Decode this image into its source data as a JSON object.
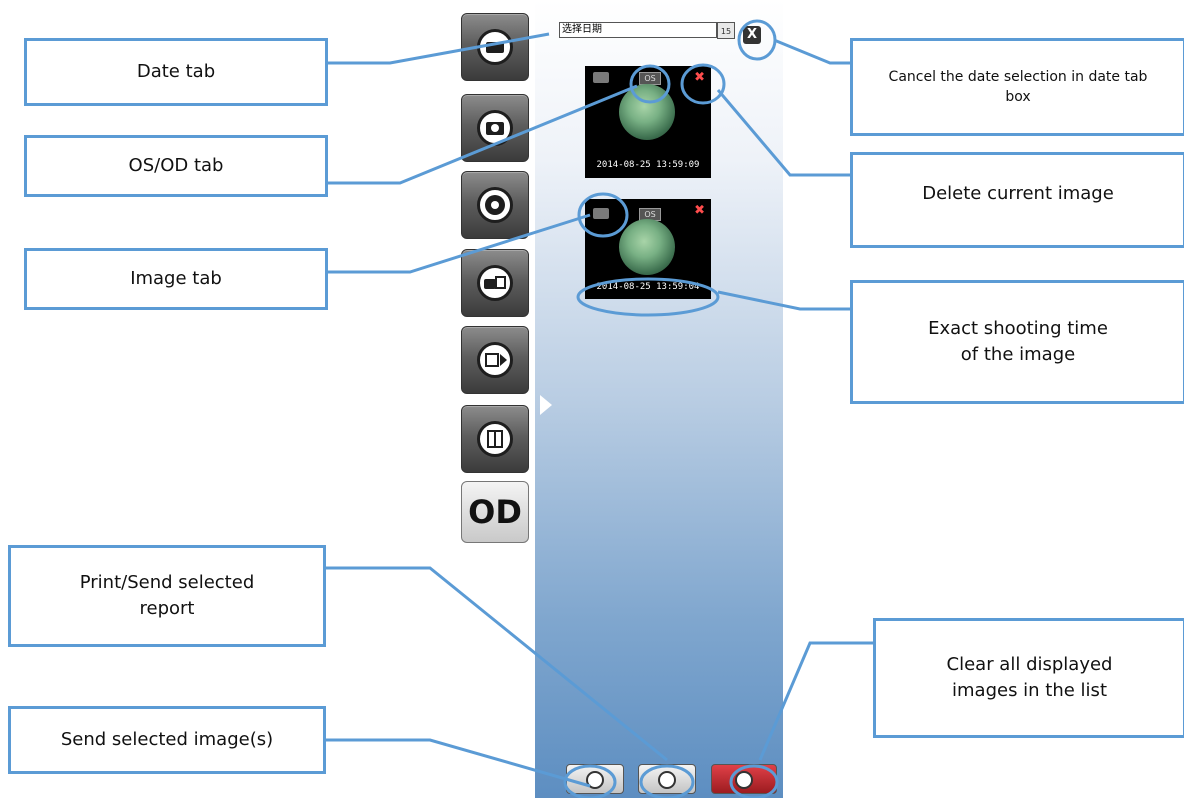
{
  "callouts": {
    "date_tab": "Date tab",
    "os_od_tab": "OS/OD tab",
    "image_tab": "Image tab",
    "print_send_report": "Print/Send selected report",
    "send_images": "Send selected image(s)",
    "cancel_date": "Cancel the date selection in date tab box",
    "delete_image": "Delete current image",
    "shooting_time": "Exact shooting time of the image",
    "clear_images": "Clear all displayed images in the list"
  },
  "date_input": {
    "value": "选择日期",
    "calendar_icon": "15"
  },
  "cancel_label": "X",
  "od_label": "OD",
  "thumbnails": [
    {
      "eye": "OS",
      "timestamp": "2014-08-25 13:59:09"
    },
    {
      "eye": "OS",
      "timestamp": "2014-08-25 13:59:04"
    }
  ],
  "sidebar_icons": [
    "date-icon",
    "camera-icon",
    "settings-icon",
    "import-icon",
    "export-image-icon",
    "compare-icon"
  ],
  "colors": {
    "callout_border": "#5b9bd5",
    "clear_button": "#c0282d"
  }
}
